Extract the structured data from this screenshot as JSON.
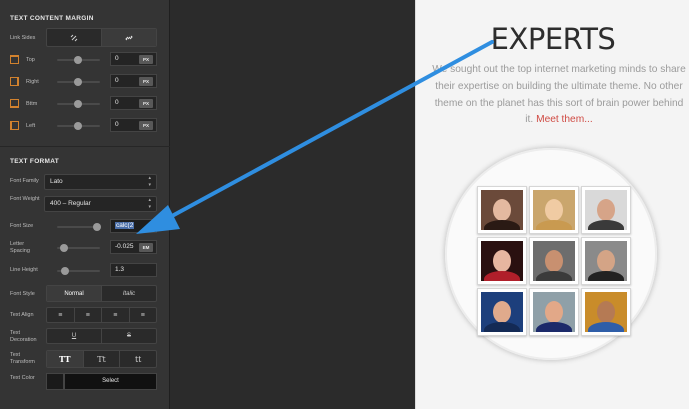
{
  "panel": {
    "margin": {
      "title": "TEXT CONTENT MARGIN",
      "link_sides_label": "Link Sides",
      "unlink_icon": "unlink-icon",
      "link_icon": "link-icon",
      "rows": [
        {
          "label": "Top",
          "value": "0",
          "unit": "PX",
          "icon": "margin-top-icon"
        },
        {
          "label": "Right",
          "value": "0",
          "unit": "PX",
          "icon": "margin-right-icon"
        },
        {
          "label": "Bttm",
          "value": "0",
          "unit": "PX",
          "icon": "margin-bottom-icon"
        },
        {
          "label": "Left",
          "value": "0",
          "unit": "PX",
          "icon": "margin-left-icon"
        }
      ]
    },
    "format": {
      "title": "TEXT FORMAT",
      "font_family_label": "Font Family",
      "font_family_value": "Lato",
      "font_weight_label": "Font Weight",
      "font_weight_value": "400 – Regular",
      "font_size_label": "Font Size",
      "font_size_value": "calc(2",
      "letter_spacing_label": "Letter Spacing",
      "letter_spacing_value": "-0.025",
      "letter_spacing_unit": "EM",
      "line_height_label": "Line Height",
      "line_height_value": "1.3",
      "font_style_label": "Font Style",
      "font_style_normal": "Normal",
      "font_style_italic": "Italic",
      "text_align_label": "Text Align",
      "text_decoration_label": "Text Decoration",
      "decoration_underline": "U",
      "decoration_strike": "S",
      "text_transform_label": "Text Transform",
      "transform_upper": "TT",
      "transform_title": "Tt",
      "transform_lower": "tt",
      "text_color_label": "Text Color",
      "text_color_select": "Select"
    }
  },
  "preview": {
    "heading": "EXPERTS",
    "blurb": "We sought out the top internet marketing minds to share their expertise on building the ultimate theme. No other theme on the planet has this sort of brain power behind it.",
    "link": "Meet them..."
  },
  "colors": {
    "accent_orange": "#d2822e",
    "arrow_blue": "#2f8ee0",
    "link_red": "#d04b44"
  }
}
